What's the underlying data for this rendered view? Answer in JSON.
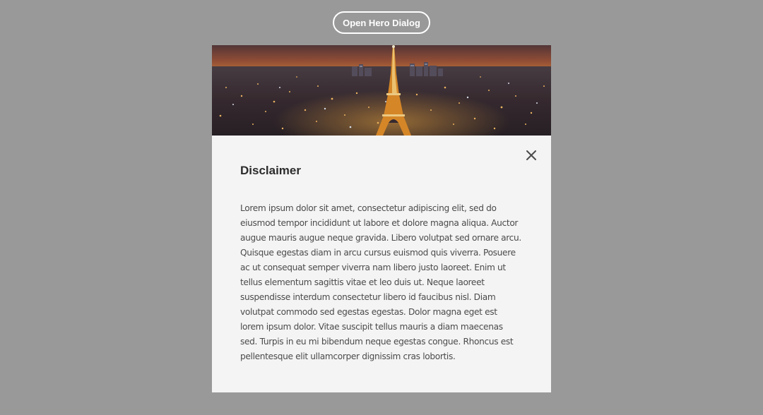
{
  "trigger": {
    "label": "Open Hero Dialog"
  },
  "dialog": {
    "hero_image": "paris-eiffel-tower-night-image",
    "close_icon": "close-icon",
    "title": "Disclaimer",
    "body": "Lorem ipsum dolor sit amet, consectetur adipiscing elit, sed do eiusmod tempor incididunt ut labore et dolore magna aliqua. Auctor augue mauris augue neque gravida. Libero volutpat sed ornare arcu. Quisque egestas diam in arcu cursus euismod quis viverra. Posuere ac ut consequat semper viverra nam libero justo laoreet. Enim ut tellus elementum sagittis vitae et leo duis ut. Neque laoreet suspendisse interdum consectetur libero id faucibus nisl. Diam volutpat commodo sed egestas egestas. Dolor magna eget est lorem ipsum dolor. Vitae suscipit tellus mauris a diam maecenas sed. Turpis in eu mi bibendum neque egestas congue. Rhoncus est pellentesque elit ullamcorper dignissim cras lobortis."
  },
  "colors": {
    "overlay": "#999999",
    "dialog_background": "#f4f4f4",
    "title_text": "#2c2c2c",
    "body_text": "#4b4b4b"
  }
}
